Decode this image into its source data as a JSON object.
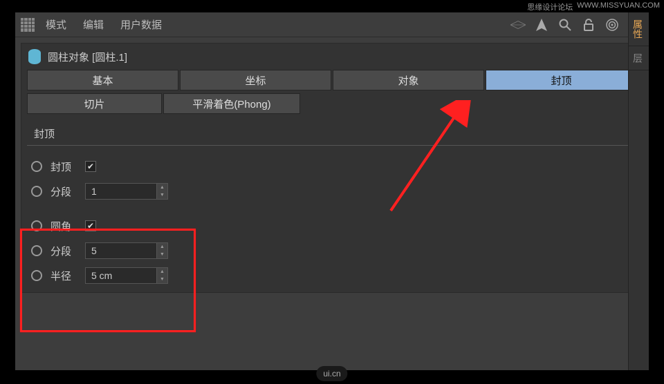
{
  "watermark": {
    "top_left": "思缘设计论坛",
    "top_right": "WWW.MISSYUAN.COM",
    "bottom": "ui.cn"
  },
  "menu": {
    "mode": "模式",
    "edit": "编辑",
    "userdata": "用户数据"
  },
  "side": {
    "attr": "属性",
    "layer": "层"
  },
  "object": {
    "title": "圆柱对象 [圆柱.1]"
  },
  "tabs": {
    "basic": "基本",
    "coord": "坐标",
    "object": "对象",
    "caps": "封顶",
    "slice": "切片",
    "phong": "平滑着色(Phong)"
  },
  "section": {
    "caps": "封顶"
  },
  "props": {
    "caps_label": "封顶",
    "seg_label": "分段",
    "seg_val": "1",
    "fillet_label": "圆角",
    "fillet_seg_label": "分段",
    "fillet_seg_val": "5",
    "radius_label": "半径",
    "radius_val": "5 cm"
  }
}
